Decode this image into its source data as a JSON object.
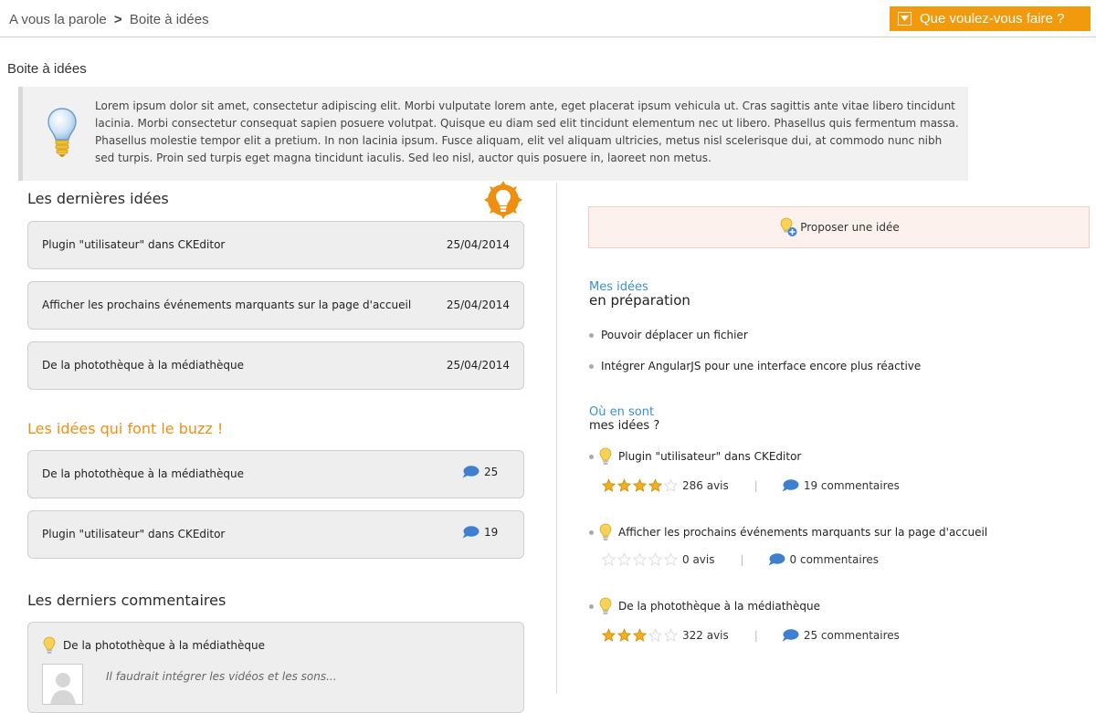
{
  "breadcrumb": {
    "parent": "A vous la parole",
    "separator": ">",
    "current": "Boite à idées"
  },
  "action_button": {
    "label": "Que voulez-vous faire ?"
  },
  "page_title": "Boite à idées",
  "intro_text": "Lorem ipsum dolor sit amet, consectetur adipiscing elit. Morbi vulputate lorem ante, eget placerat ipsum vehicula ut. Cras sagittis ante vitae libero tincidunt lacinia. Morbi consectetur consequat sapien posuere volutpat. Quisque eu diam sed elit tincidunt elementum nec ut libero. Phasellus quis fermentum massa. Phasellus molestie tempor elit a pretium. In non lacinia ipsum. Fusce aliquam, elit vel aliquam ultricies, metus nisl scelerisque dui, at commodo nunc nibh sed turpis. Proin sed turpis eget magna tincidunt iaculis. Sed leo nisl, auctor quis posuere in, laoreet non metus.",
  "latest_ideas": {
    "title": "Les dernières idées",
    "items": [
      {
        "title": "Plugin \"utilisateur\" dans CKEditor",
        "date": "25/04/2014"
      },
      {
        "title": "Afficher les prochains événements marquants sur la page d'accueil",
        "date": "25/04/2014"
      },
      {
        "title": "De la photothèque à la médiathèque",
        "date": "25/04/2014"
      }
    ]
  },
  "buzz": {
    "title": "Les idées qui font le buzz !",
    "items": [
      {
        "title": "De la photothèque à la médiathèque",
        "count": "25"
      },
      {
        "title": "Plugin \"utilisateur\" dans CKEditor",
        "count": "19"
      }
    ]
  },
  "latest_comments": {
    "title": "Les derniers commentaires",
    "items": [
      {
        "title": "De la photothèque à la médiathèque",
        "text": "Il faudrait intégrer les vidéos et les sons..."
      }
    ]
  },
  "propose_button": {
    "label": "Proposer une idée"
  },
  "my_ideas": {
    "title_line1": "Mes idées",
    "title_line2": "en préparation",
    "items": [
      "Pouvoir déplacer un fichier",
      "Intégrer AngularJS pour une interface encore plus réactive"
    ]
  },
  "status": {
    "title_line1": "Où en sont",
    "title_line2": "mes idées ?",
    "items": [
      {
        "title": "Plugin \"utilisateur\" dans CKEditor",
        "rating": 4,
        "max_rating": 5,
        "reviews": "286 avis",
        "comments": "19 commentaires"
      },
      {
        "title": "Afficher les prochains événements marquants sur la page d'accueil",
        "rating": 0,
        "max_rating": 5,
        "reviews": "0 avis",
        "comments": "0 commentaires"
      },
      {
        "title": "De la photothèque à la médiathèque",
        "rating": 3,
        "max_rating": 5,
        "reviews": "322 avis",
        "comments": "25 commentaires"
      }
    ]
  },
  "colors": {
    "accent_orange": "#f29a0e",
    "link_blue": "#3b8fd0",
    "star_gold": "#f2b01e",
    "star_empty": "#d9d9d9"
  },
  "icons": {
    "intro": "lightbulb-icon",
    "latest_badge": "lightbulb-badge-icon",
    "comment": "speech-bubble-icon",
    "propose": "lightbulb-add-icon",
    "dropdown": "dropdown-arrow-icon"
  }
}
